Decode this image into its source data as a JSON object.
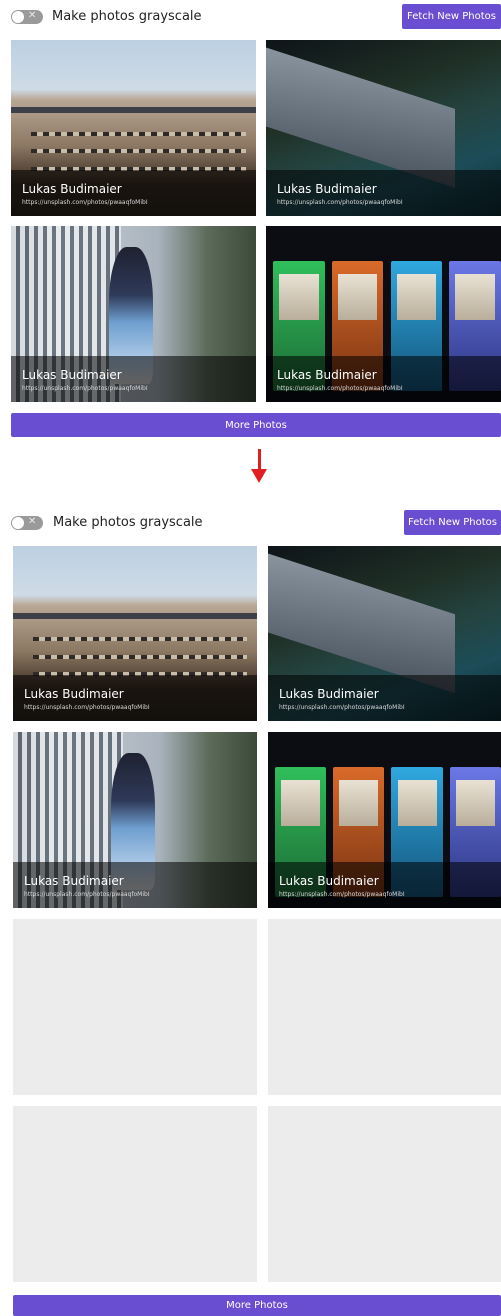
{
  "panels": [
    {
      "toggle_label": "Make photos grayscale",
      "fetch_button": "Fetch New Photos",
      "more_button": "More Photos",
      "photos": [
        {
          "author": "Lukas Budimaier",
          "url": "https://unsplash.com/photos/pwaaqfoMibI",
          "subject": "building"
        },
        {
          "author": "Lukas Budimaier",
          "url": "https://unsplash.com/photos/pwaaqfoMibI",
          "subject": "coast"
        },
        {
          "author": "Lukas Budimaier",
          "url": "https://unsplash.com/photos/pwaaqfoMibI",
          "subject": "runner"
        },
        {
          "author": "Lukas Budimaier",
          "url": "https://unsplash.com/photos/pwaaqfoMibI",
          "subject": "machines"
        }
      ]
    },
    {
      "toggle_label": "Make photos grayscale",
      "fetch_button": "Fetch New Photos",
      "more_button": "More Photos",
      "photos": [
        {
          "author": "Lukas Budimaier",
          "url": "https://unsplash.com/photos/pwaaqfoMibI",
          "subject": "building"
        },
        {
          "author": "Lukas Budimaier",
          "url": "https://unsplash.com/photos/pwaaqfoMibI",
          "subject": "coast"
        },
        {
          "author": "Lukas Budimaier",
          "url": "https://unsplash.com/photos/pwaaqfoMibI",
          "subject": "runner"
        },
        {
          "author": "Lukas Budimaier",
          "url": "https://unsplash.com/photos/pwaaqfoMibI",
          "subject": "machines"
        }
      ],
      "loading_placeholders": 4
    }
  ],
  "colors": {
    "accent": "#6a4ed1",
    "arrow": "#e21f1f",
    "placeholder": "#ececec"
  },
  "icons": {
    "transition": "down-arrow-icon",
    "toggle_off": "close-icon"
  }
}
